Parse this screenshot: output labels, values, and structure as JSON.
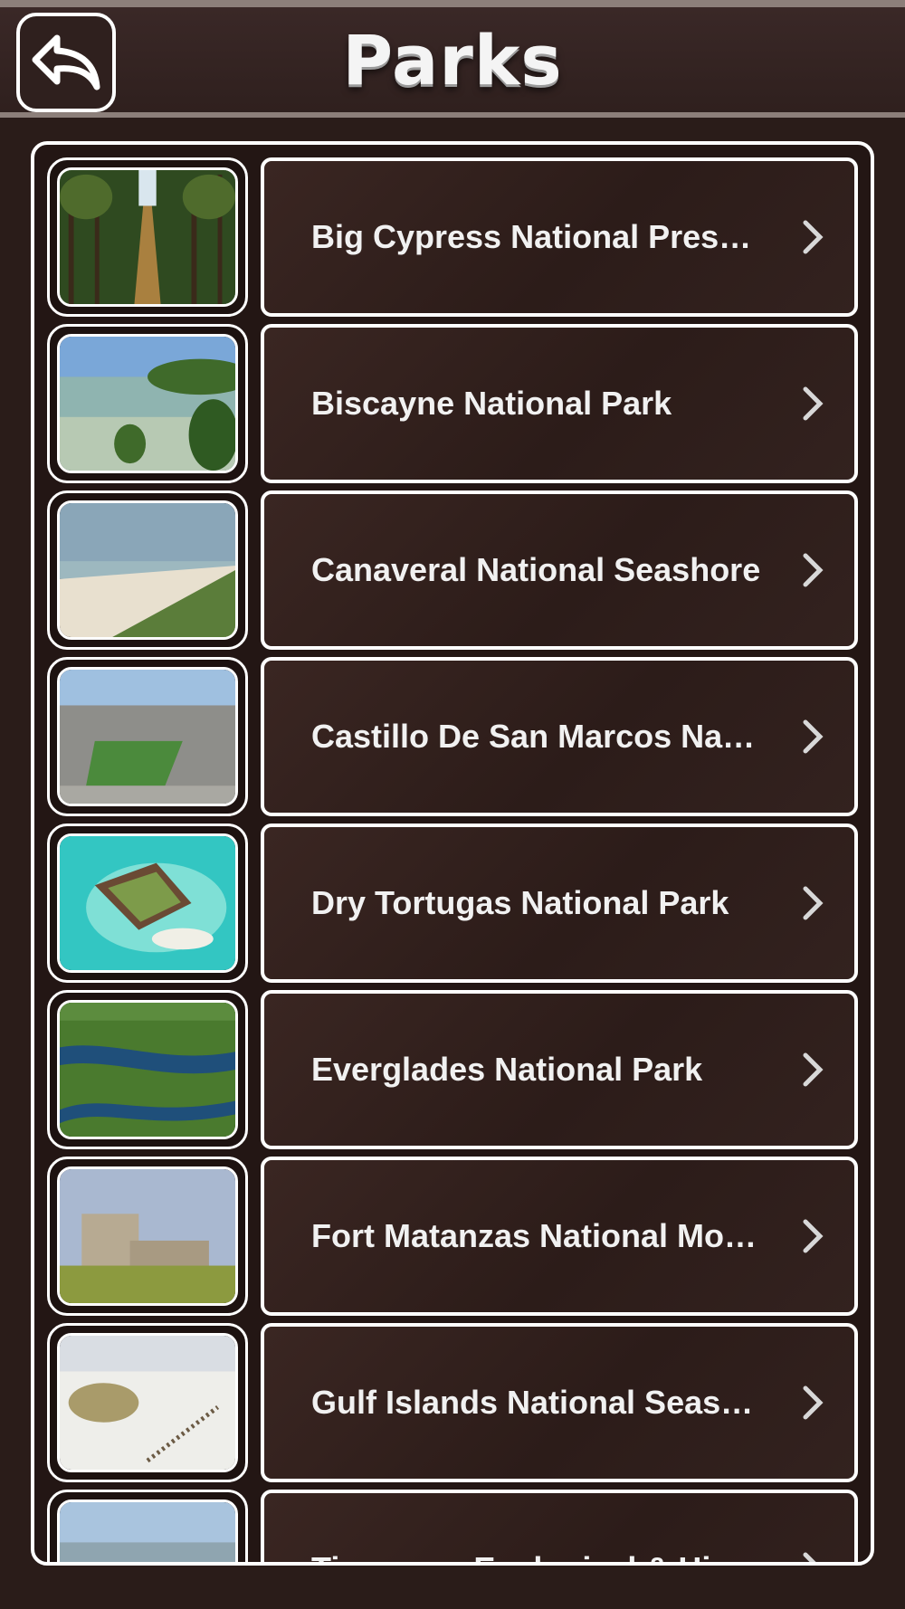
{
  "header": {
    "title": "Parks",
    "back_icon": "back-arrow-icon"
  },
  "colors": {
    "header_background": "#35252a",
    "row_background": "#2f1f1c",
    "border": "#ffffff",
    "text": "#f1f1f1"
  },
  "parks": [
    {
      "name": "Big Cypress National Pres…",
      "thumbnail": "cypress-swamp"
    },
    {
      "name": "Biscayne National Park",
      "thumbnail": "mangrove-shore"
    },
    {
      "name": "Canaveral National Seashore",
      "thumbnail": "beach"
    },
    {
      "name": "Castillo De San Marcos Na…",
      "thumbnail": "stone-fort"
    },
    {
      "name": "Dry Tortugas National Park",
      "thumbnail": "island-fort"
    },
    {
      "name": "Everglades National Park",
      "thumbnail": "wetlands-aerial"
    },
    {
      "name": "Fort Matanzas National Mo…",
      "thumbnail": "fort-tower"
    },
    {
      "name": "Gulf Islands National Seas…",
      "thumbnail": "sand-dunes"
    },
    {
      "name": "Timucuan Ecological & Hi…",
      "thumbnail": "coastal-town"
    }
  ]
}
